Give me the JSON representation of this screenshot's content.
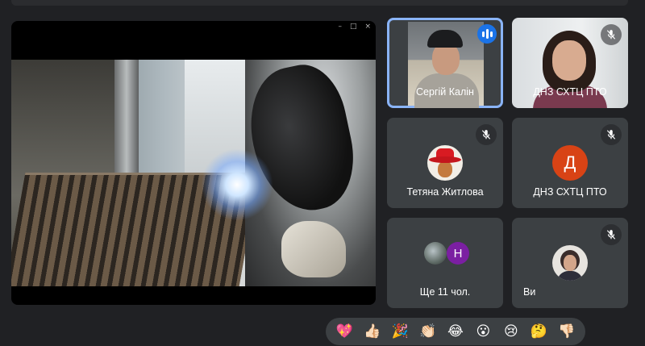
{
  "presentation": {
    "window_controls": [
      "–",
      "□",
      "×"
    ]
  },
  "participants": [
    {
      "name": "Сергій Калін",
      "speaking": true,
      "muted": false
    },
    {
      "name": "ДНЗ СХТЦ ПТО",
      "speaking": false,
      "muted": true
    },
    {
      "name": "Тетяна Житлова",
      "speaking": false,
      "muted": true
    },
    {
      "name": "ДНЗ СХТЦ ПТО",
      "speaking": false,
      "muted": true,
      "avatar_letter": "Д"
    },
    {
      "name": "Ще 11 чол.",
      "mini_avatar_letter": "Н"
    },
    {
      "name": "Ви",
      "speaking": false,
      "muted": true
    }
  ],
  "icons": {
    "muted": "mic-off-icon",
    "speaking": "audio-level-icon"
  },
  "colors": {
    "background": "#202124",
    "tile": "#3c4043",
    "active_outline": "#8ab4f8",
    "speaking": "#1a73e8",
    "avatar_d": "#d84315",
    "avatar_n": "#7b1fa2"
  },
  "reactions": [
    {
      "name": "sparkling-heart",
      "glyph": "💖"
    },
    {
      "name": "thumbs-up",
      "glyph": "👍🏻"
    },
    {
      "name": "party-popper",
      "glyph": "🎉"
    },
    {
      "name": "clapping-hands",
      "glyph": "👏🏻"
    },
    {
      "name": "tears-of-joy",
      "glyph": "😂"
    },
    {
      "name": "astonished",
      "glyph": "😮"
    },
    {
      "name": "crying",
      "glyph": "😢"
    },
    {
      "name": "thinking",
      "glyph": "🤔"
    },
    {
      "name": "thumbs-down",
      "glyph": "👎🏻"
    }
  ]
}
